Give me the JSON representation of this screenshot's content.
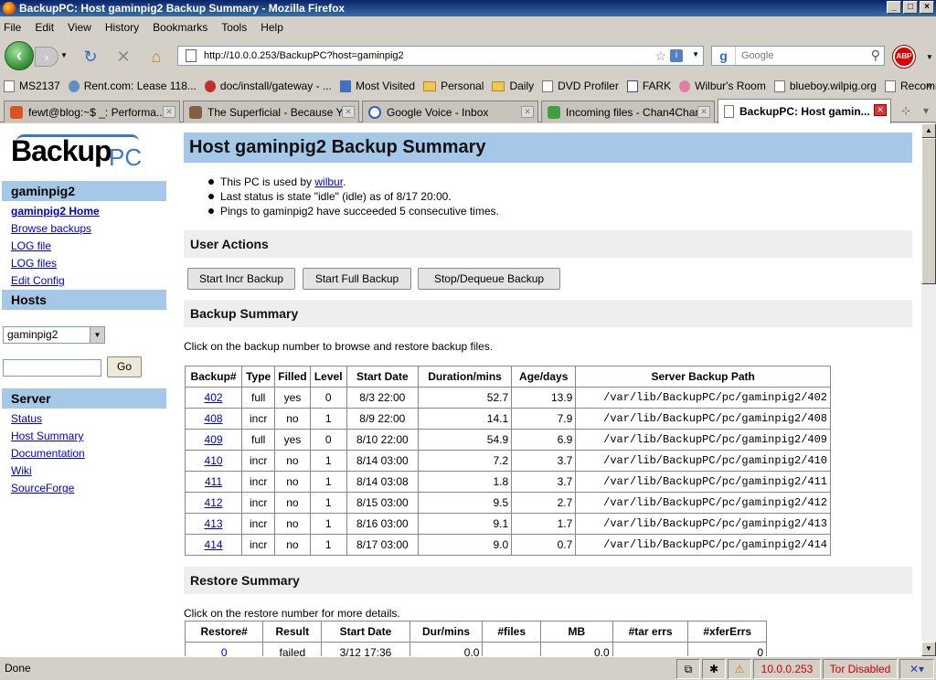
{
  "window": {
    "title": "BackupPC: Host gaminpig2 Backup Summary - Mozilla Firefox",
    "min": "_",
    "max": "□",
    "close": "×"
  },
  "menu": [
    "File",
    "Edit",
    "View",
    "History",
    "Bookmarks",
    "Tools",
    "Help"
  ],
  "nav": {
    "url": "http://10.0.0.253/BackupPC?host=gaminpig2",
    "search_placeholder": "Google",
    "abp": "ABP"
  },
  "bookmarks": [
    {
      "label": "MS2137",
      "icon": "page-icon"
    },
    {
      "label": "Rent.com: Lease 118...",
      "icon": "rent-icon"
    },
    {
      "label": "doc/install/gateway - ...",
      "icon": "doc-icon"
    },
    {
      "label": "Most Visited",
      "icon": "most-visited-icon"
    },
    {
      "label": "Personal",
      "icon": "folder-icon"
    },
    {
      "label": "Daily",
      "icon": "folder-icon"
    },
    {
      "label": "DVD Profiler",
      "icon": "page-icon"
    },
    {
      "label": "FARK",
      "icon": "fark-icon"
    },
    {
      "label": "Wilbur's Room",
      "icon": "wilbur-icon"
    },
    {
      "label": "blueboy.wilpig.org",
      "icon": "page-icon"
    },
    {
      "label": "Recommend",
      "icon": "page-icon"
    }
  ],
  "bookmarks_more": "»",
  "tabs": [
    {
      "label": "fewt@blog:~$ _: Performa...",
      "active": false,
      "color": "#e05020"
    },
    {
      "label": "The Superficial - Because Y...",
      "active": false,
      "color": "#806040"
    },
    {
      "label": "Google Voice - Inbox",
      "active": false,
      "color": "#3060c0"
    },
    {
      "label": "Incoming files - Chan4Chan",
      "active": false,
      "color": "#40a040"
    },
    {
      "label": "BackupPC: Host gamin...",
      "active": true,
      "color": "#eeeeee"
    }
  ],
  "sidebar": {
    "logo_left": "Backup",
    "logo_right": "PC",
    "host_heading": "gaminpig2",
    "host_links": [
      "gaminpig2 Home",
      "Browse backups",
      "LOG file",
      "LOG files",
      "Edit Config"
    ],
    "hosts_heading": "Hosts",
    "host_select_value": "gaminpig2",
    "go_label": "Go",
    "server_heading": "Server",
    "server_links": [
      "Status",
      "Host Summary",
      "Documentation",
      "Wiki",
      "SourceForge"
    ]
  },
  "main": {
    "title": "Host gaminpig2 Backup Summary",
    "bullet1_pre": "This PC is used by ",
    "bullet1_link": "wilbur",
    "bullet1_post": ".",
    "bullet2": "Last status is state \"idle\" (idle) as of 8/17 20:00.",
    "bullet3": "Pings to gaminpig2 have succeeded 5 consecutive times.",
    "user_actions": "User Actions",
    "buttons": [
      "Start Incr Backup",
      "Start Full Backup",
      "Stop/Dequeue Backup"
    ],
    "backup_summary": "Backup Summary",
    "backup_note": "Click on the backup number to browse and restore backup files.",
    "backup_headers": [
      "Backup#",
      "Type",
      "Filled",
      "Level",
      "Start Date",
      "Duration/mins",
      "Age/days",
      "Server Backup Path"
    ],
    "backups": [
      [
        "402",
        "full",
        "yes",
        "0",
        "8/3 22:00",
        "52.7",
        "13.9",
        "/var/lib/BackupPC/pc/gaminpig2/402"
      ],
      [
        "408",
        "incr",
        "no",
        "1",
        "8/9 22:00",
        "14.1",
        "7.9",
        "/var/lib/BackupPC/pc/gaminpig2/408"
      ],
      [
        "409",
        "full",
        "yes",
        "0",
        "8/10 22:00",
        "54.9",
        "6.9",
        "/var/lib/BackupPC/pc/gaminpig2/409"
      ],
      [
        "410",
        "incr",
        "no",
        "1",
        "8/14 03:00",
        "7.2",
        "3.7",
        "/var/lib/BackupPC/pc/gaminpig2/410"
      ],
      [
        "411",
        "incr",
        "no",
        "1",
        "8/14 03:08",
        "1.8",
        "3.7",
        "/var/lib/BackupPC/pc/gaminpig2/411"
      ],
      [
        "412",
        "incr",
        "no",
        "1",
        "8/15 03:00",
        "9.5",
        "2.7",
        "/var/lib/BackupPC/pc/gaminpig2/412"
      ],
      [
        "413",
        "incr",
        "no",
        "1",
        "8/16 03:00",
        "9.1",
        "1.7",
        "/var/lib/BackupPC/pc/gaminpig2/413"
      ],
      [
        "414",
        "incr",
        "no",
        "1",
        "8/17 03:00",
        "9.0",
        "0.7",
        "/var/lib/BackupPC/pc/gaminpig2/414"
      ]
    ],
    "restore_summary": "Restore Summary",
    "restore_note": "Click on the restore number for more details.",
    "restore_headers": [
      "Restore#",
      "Result",
      "Start Date",
      "Dur/mins",
      "#files",
      "MB",
      "#tar errs",
      "#xferErrs"
    ],
    "restores": [
      [
        "0",
        "failed",
        "3/12 17:36",
        "0.0",
        "",
        "0.0",
        "",
        "0"
      ]
    ]
  },
  "status": {
    "text": "Done",
    "ip": "10.0.0.253",
    "tor": "Tor Disabled"
  }
}
